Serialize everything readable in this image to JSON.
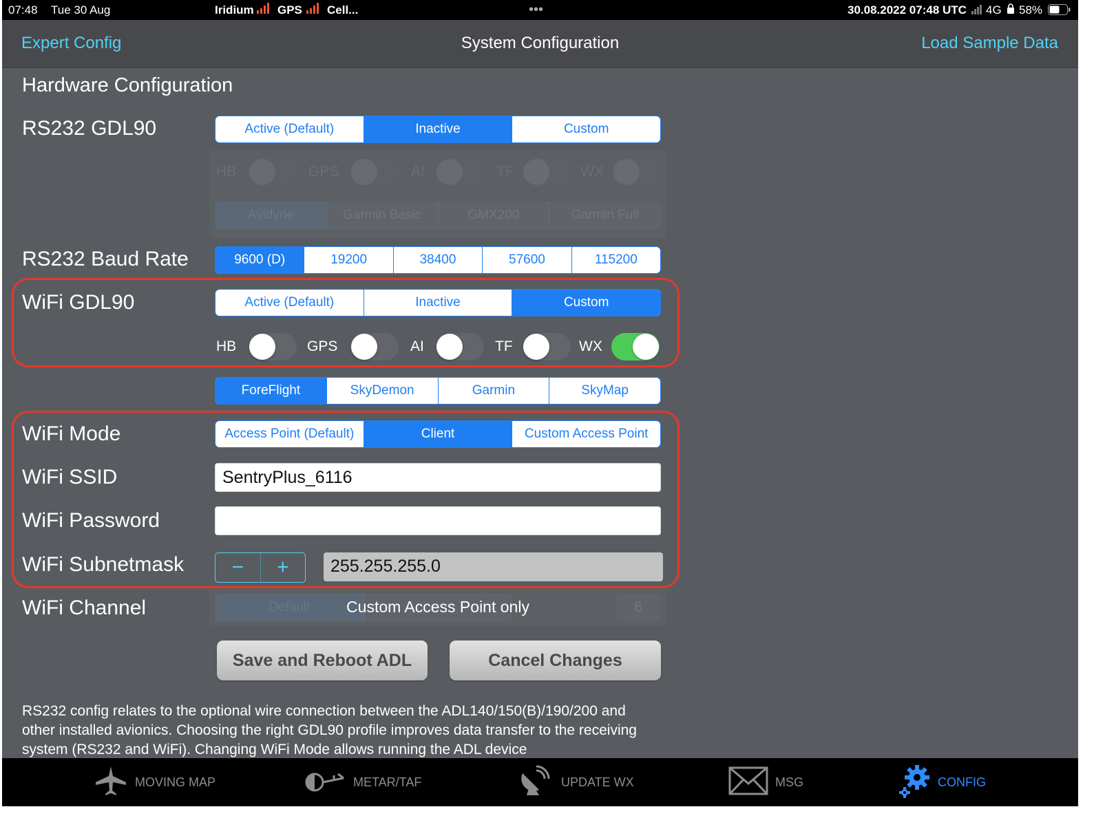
{
  "status_bar": {
    "time": "07:48",
    "date": "Tue 30 Aug",
    "iridium": "Iridium",
    "gps": "GPS",
    "cell": "Cell...",
    "dots": "•••",
    "utc": "30.08.2022  07:48 UTC",
    "network": "4G",
    "battery": "58%"
  },
  "nav": {
    "left": "Expert Config",
    "title": "System Configuration",
    "right": "Load Sample Data"
  },
  "section_title": "Hardware Configuration",
  "rs232_gdl90": {
    "label": "RS232 GDL90",
    "options": [
      "Active (Default)",
      "Inactive",
      "Custom"
    ],
    "selected": 1,
    "toggles": [
      "HB",
      "GPS",
      "AI",
      "TF",
      "WX"
    ],
    "profiles": [
      "Avidyne",
      "Garmin Basic",
      "GMX200",
      "Garmin Full"
    ]
  },
  "baud_rate": {
    "label": "RS232 Baud Rate",
    "options": [
      "9600 (D)",
      "19200",
      "38400",
      "57600",
      "115200"
    ],
    "selected": 0
  },
  "wifi_gdl90": {
    "label": "WiFi GDL90",
    "options": [
      "Active (Default)",
      "Inactive",
      "Custom"
    ],
    "selected": 2,
    "toggles": [
      "HB",
      "GPS",
      "AI",
      "TF",
      "WX"
    ],
    "toggle_states": [
      false,
      false,
      false,
      false,
      true
    ]
  },
  "wifi_profile": {
    "options": [
      "ForeFlight",
      "SkyDemon",
      "Garmin",
      "SkyMap"
    ],
    "selected": 0
  },
  "wifi_mode": {
    "label": "WiFi Mode",
    "options": [
      "Access Point (Default)",
      "Client",
      "Custom Access Point"
    ],
    "selected": 1
  },
  "wifi_ssid": {
    "label": "WiFi SSID",
    "value": "SentryPlus_6116"
  },
  "wifi_password": {
    "label": "WiFi Password",
    "value": ""
  },
  "wifi_subnetmask": {
    "label": "WiFi Subnetmask",
    "minus": "−",
    "plus": "+",
    "value": "255.255.255.0"
  },
  "wifi_channel": {
    "label": "WiFi Channel",
    "option_default": "Default",
    "overlay": "Custom Access Point only",
    "value": "6"
  },
  "buttons": {
    "save": "Save and Reboot ADL",
    "cancel": "Cancel Changes"
  },
  "info_text": "RS232 config relates to the optional wire connection between the ADL140/150(B)/190/200 and other installed avionics. Choosing the right GDL90 profile improves data transfer to the receiving system (RS232 and WiFi). Changing WiFi Mode allows running the ADL device",
  "tabs": [
    {
      "label": "MOVING MAP",
      "icon": "airplane-icon"
    },
    {
      "label": "METAR/TAF",
      "icon": "gauge-icon"
    },
    {
      "label": "UPDATE WX",
      "icon": "satellite-dish-icon"
    },
    {
      "label": "MSG",
      "icon": "envelope-icon"
    },
    {
      "label": "CONFIG",
      "icon": "gear-icon"
    }
  ],
  "active_tab": 4,
  "colors": {
    "accent": "#1f7ff2",
    "link": "#4fd2f4",
    "highlight": "#e23a2a",
    "toggle_on": "#4ccb58"
  }
}
